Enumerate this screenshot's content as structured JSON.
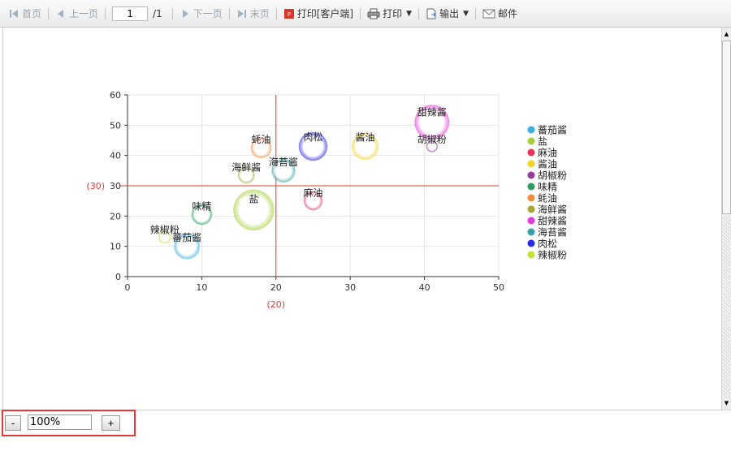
{
  "toolbar": {
    "first": "首页",
    "prev": "上一页",
    "page_value": "1",
    "page_total": "/1",
    "next": "下一页",
    "last": "末页",
    "print_client": "打印[客户端]",
    "print": "打印",
    "export": "输出",
    "mail": "邮件"
  },
  "zoom": {
    "minus": "-",
    "value": "100%",
    "plus": "+"
  },
  "colors": {
    "crosshair": "#e53935",
    "grid": "#e6e6e6",
    "axis": "#333333"
  },
  "chart_data": {
    "type": "scatter",
    "subtype": "bubble",
    "title": "",
    "xlabel": "",
    "ylabel": "",
    "xlim": [
      0,
      50
    ],
    "ylim": [
      0,
      60
    ],
    "xticks": [
      "0",
      "10",
      "20",
      "30",
      "40",
      "50"
    ],
    "yticks": [
      "0",
      "10",
      "20",
      "30",
      "40",
      "50",
      "60"
    ],
    "grid": true,
    "legend_position": "right",
    "reference_lines": {
      "x": 20,
      "x_label": "(20)",
      "y": 30,
      "y_label": "(30)"
    },
    "points": [
      {
        "name": "蕃茄酱",
        "x": 8,
        "y": 10,
        "size": 2.5,
        "color": "#3bb0e0"
      },
      {
        "name": "盐",
        "x": 17,
        "y": 22,
        "size": 4,
        "color": "#a6cf3a"
      },
      {
        "name": "麻油",
        "x": 25,
        "y": 25,
        "size": 1.8,
        "color": "#e8345c"
      },
      {
        "name": "酱油",
        "x": 32,
        "y": 43,
        "size": 2.6,
        "color": "#f4d22a"
      },
      {
        "name": "胡椒粉",
        "x": 41,
        "y": 43,
        "size": 1.1,
        "color": "#943b9c"
      },
      {
        "name": "味精",
        "x": 10,
        "y": 20.5,
        "size": 2,
        "color": "#2c9e62"
      },
      {
        "name": "蚝油",
        "x": 18,
        "y": 42.5,
        "size": 2,
        "color": "#f48a3c"
      },
      {
        "name": "海鲜酱",
        "x": 16,
        "y": 33.5,
        "size": 1.6,
        "color": "#a8a43a"
      },
      {
        "name": "甜辣酱",
        "x": 41,
        "y": 51,
        "size": 3.4,
        "color": "#e33bd8"
      },
      {
        "name": "海苔酱",
        "x": 21,
        "y": 35,
        "size": 2.3,
        "color": "#38a0a6"
      },
      {
        "name": "肉松",
        "x": 25,
        "y": 43,
        "size": 2.8,
        "color": "#2a2ae8"
      },
      {
        "name": "辣椒粉",
        "x": 5,
        "y": 13,
        "size": 1.2,
        "color": "#c8e033"
      }
    ]
  }
}
